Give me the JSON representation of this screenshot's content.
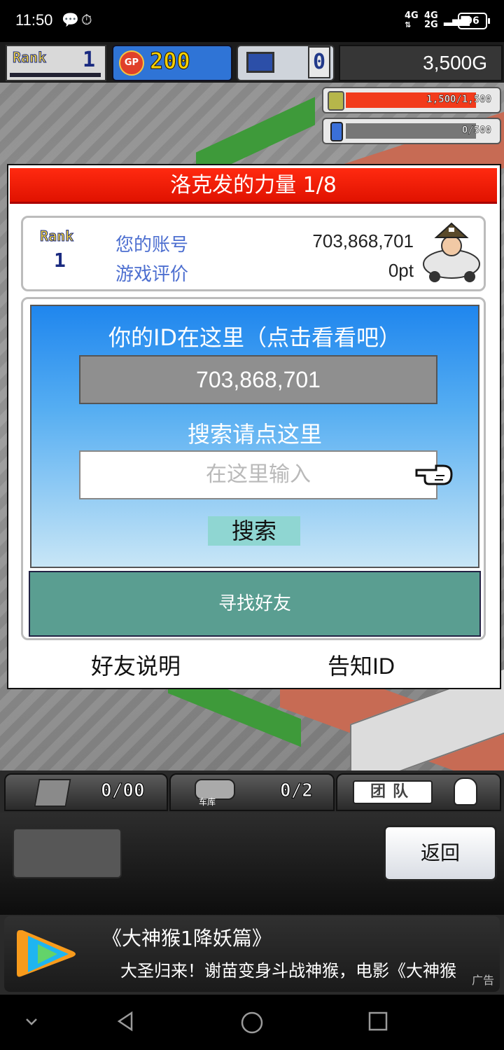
{
  "status_bar": {
    "time": "11:50",
    "net_top": "4G",
    "net_bottom": "4G",
    "net2_top": "4G",
    "net2_bottom": "2G",
    "battery": "96"
  },
  "top_bar": {
    "rank_label": "Rank",
    "rank": "1",
    "gp_label": "GP",
    "gp": "200",
    "pc_count": "0",
    "money": "3,500G"
  },
  "resources": [
    {
      "text": "1,500/1,500",
      "level": 1.0,
      "color": "#f23b1b"
    },
    {
      "text": "0/500",
      "level": 0.0,
      "color": "#4a86e8"
    }
  ],
  "dialog": {
    "title": "洛克发的力量 1/8",
    "info": {
      "rank_label": "Rank",
      "rank": "1",
      "account_label": "您的账号",
      "account_value": "703,868,701",
      "rating_label": "游戏评价",
      "rating_value": "0pt"
    },
    "search": {
      "id_title": "你的ID在这里（点击看看吧）",
      "id_value": "703,868,701",
      "search_hint": "搜索请点这里",
      "input_placeholder": "在这里输入",
      "search_button": "搜索"
    },
    "find_friends": "寻找好友",
    "friend_help": "好友说明",
    "share_id": "告知ID"
  },
  "bottom_tabs": {
    "storage_count": "0/00",
    "garage_label": "车库",
    "garage_count": "0/2",
    "team_label": "团队"
  },
  "panel": {
    "back_label": "返回"
  },
  "ad": {
    "title": "《大神猴1降妖篇》",
    "desc": "大圣归来！谢苗变身斗战神猴，电影《大神猴",
    "badge": "广告"
  }
}
